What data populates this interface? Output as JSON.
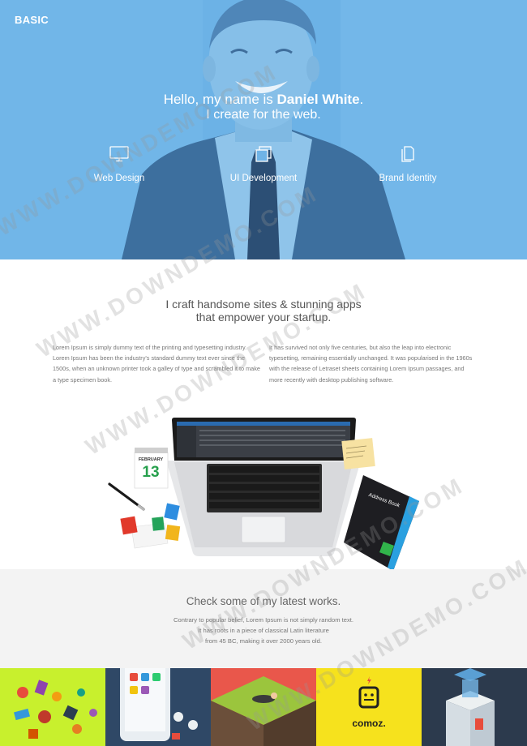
{
  "brand": "BASIC",
  "hero": {
    "greeting": "Hello, my name is ",
    "name": "Daniel White",
    "period": ".",
    "tagline": "I create for the web."
  },
  "services": [
    {
      "label": "Web Design",
      "icon": "monitor-icon"
    },
    {
      "label": "UI Development",
      "icon": "layers-icon"
    },
    {
      "label": "Brand Identity",
      "icon": "document-icon"
    }
  ],
  "about": {
    "title_line1": "I craft handsome sites & stunning apps",
    "title_line2": "that empower your startup.",
    "para_left": "Lorem Ipsum is simply dummy text of the printing and typesetting industry. Lorem Ipsum has been the industry's standard dummy text ever since the 1500s, when an unknown printer took a galley of type and scrambled it to make a type specimen book.",
    "para_right": "It has survived not only five centuries, but also the leap into electronic typesetting, remaining essentially unchanged. It was popularised in the 1960s with the release of Letraset sheets containing Lorem Ipsum passages, and more recently with desktop publishing software.",
    "calendar_month": "FEBRUARY",
    "calendar_day": "13",
    "notebook_label": "Address Book"
  },
  "works": {
    "title": "Check some of my latest works.",
    "desc_lines": [
      "Contrary to popular belief, Lorem Ipsum is not simply random text.",
      "It has roots in a piece of classical Latin literature",
      "from 45 BC, making it over 2000 years old."
    ]
  },
  "gallery": {
    "comoz_label": "comoz."
  },
  "watermark": "WWW.DOWNDEMO.COM",
  "colors": {
    "hero_blue": "#6fb3e6",
    "works_bg": "#f3f3f3",
    "calendar_green": "#27a04d",
    "tile_lime": "#c8f02d",
    "tile_navy": "#2f4866",
    "tile_red": "#e9574b",
    "tile_yellow": "#f6e21d",
    "tile_dark": "#2c3a4d"
  }
}
